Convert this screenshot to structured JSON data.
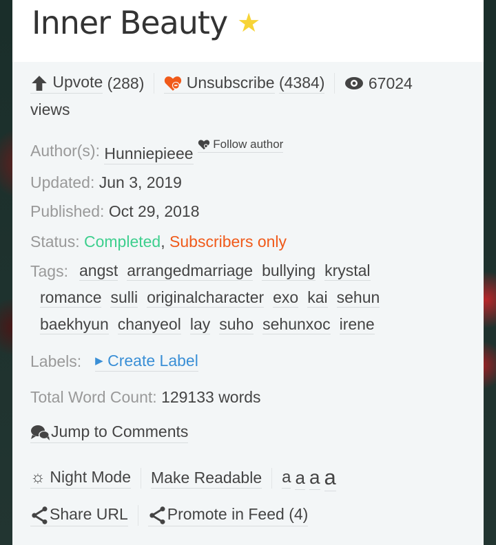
{
  "title": "Inner Beauty",
  "stats": {
    "upvote_label": "Upvote",
    "upvote_count": "(288)",
    "unsubscribe_label": "Unsubscribe",
    "subscribers": "(4384)",
    "views": "67024",
    "views_suffix": "views"
  },
  "author": {
    "label": "Author(s):",
    "name": "Hunniepieee",
    "follow": "Follow author"
  },
  "updated": {
    "label": "Updated:",
    "value": "Jun 3, 2019"
  },
  "published": {
    "label": "Published:",
    "value": "Oct 29, 2018"
  },
  "status": {
    "label": "Status:",
    "completed": "Completed",
    "comma": ",",
    "subscribers_only": "Subscribers only"
  },
  "tags": {
    "label": "Tags:",
    "items": [
      "angst",
      "arrangedmarriage",
      "bullying",
      "krystal",
      "romance",
      "sulli",
      "originalcharacter",
      "exo",
      "kai",
      "sehun",
      "baekhyun",
      "chanyeol",
      "lay",
      "suho",
      "sehunxoc",
      "irene"
    ]
  },
  "labels": {
    "label": "Labels:",
    "create": "Create Label"
  },
  "wordcount": {
    "label": "Total Word Count:",
    "value": "129133 words"
  },
  "actions": {
    "comments": "Jump to Comments",
    "night": "Night Mode",
    "readable": "Make Readable",
    "sizes": [
      "a",
      "a",
      "a",
      "a"
    ],
    "share": "Share URL",
    "promote": "Promote in Feed (4)"
  },
  "colors": {
    "completed": "#3ecf8e",
    "subscribers_only": "#f05a1a",
    "link": "#3a8fd6",
    "star": "#f7d437"
  }
}
